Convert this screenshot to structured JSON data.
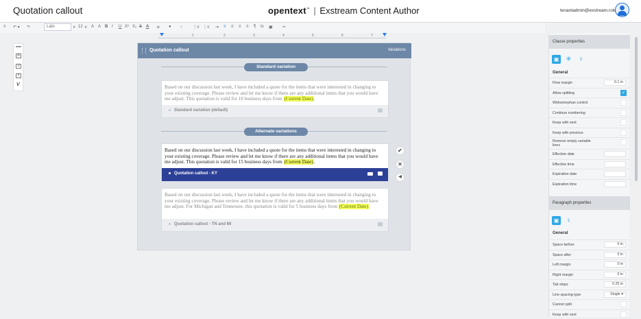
{
  "header": {
    "title": "Quotation callout",
    "brand_name": "opentext",
    "brand_sep": "|",
    "product": "Exstream Content Author",
    "user": "tenantadmin@exstream.role"
  },
  "toolbar": {
    "font": "Lato",
    "size": "12",
    "items": [
      "≡",
      "↶ ▾",
      "↷",
      "A",
      "A",
      "B",
      "I",
      "U",
      "X²",
      "X₂",
      "S",
      "A",
      "⌀",
      "●",
      "⁘",
      "⋮≡",
      "⋮≡",
      "⇥",
      "≡",
      "≡",
      "≡",
      "≡",
      "¶",
      "Ix",
      "▣",
      "✂"
    ]
  },
  "ruler": {
    "marks": [
      "1",
      "2",
      "3",
      "4",
      "5",
      "6",
      "7"
    ]
  },
  "doc": {
    "title": "Quotation callout",
    "variations_link": "Variations",
    "standard_pill": "Standard variation",
    "alternate_pill": "Alternate variations",
    "cards": [
      {
        "text": "Based on our discussion last week, I have included a quote for the items that were interested in changing to your existing coverage.  Please review and let me know if there are any additional items that you would have me adjust.  This quotation is valid for 10 business days from ",
        "date": "(Current Date)",
        "end": ".",
        "label": "Standard variation (default)"
      },
      {
        "text": "Based on our discussion last week, I have included a quote for the items that were interested in changing to your existing coverage.  Please review and let me know if there are any additional items that you would have me adjust.  This quotation is valid for 15 business days from ",
        "date": "(Current Date)",
        "end": ".",
        "label": "Quotation callout - KY"
      },
      {
        "text": "Based on our discussion last week, I have included a quote for the items that were interested in changing to your existing coverage.  Please review and let me know if there are any additional items that you would have me adjust.  For Michigan and Tennessee, this quotation is valid for 5 business days from ",
        "date": "(Current Date)",
        "end": ".",
        "label": "Quotation callout - TN and MI"
      }
    ],
    "actions": {
      "accept": "✔",
      "reject": "✕",
      "back": "◀"
    }
  },
  "panel": {
    "clause_title": "Clause properties",
    "general": "General",
    "clause_rows": [
      {
        "k": "Flow margin",
        "v": "0.1 in"
      },
      {
        "k": "Allow splitting",
        "check": true
      },
      {
        "k": "Widow/orphan control",
        "check": false
      },
      {
        "k": "Continue numbering",
        "check": false
      },
      {
        "k": "Keep with next",
        "check": false
      },
      {
        "k": "Keep with previous",
        "check": false
      },
      {
        "k": "Remove empty variable lines",
        "check": false
      },
      {
        "k": "Effective date",
        "v": ""
      },
      {
        "k": "Effective time",
        "v": ""
      },
      {
        "k": "Expiration date",
        "v": ""
      },
      {
        "k": "Expiration time",
        "v": ""
      }
    ],
    "para_title": "Paragraph properties",
    "para_rows": [
      {
        "k": "Space before",
        "v": "0 in"
      },
      {
        "k": "Space after",
        "v": "0 in"
      },
      {
        "k": "Left margin",
        "v": "0 in"
      },
      {
        "k": "Right margin",
        "v": "0 in"
      },
      {
        "k": "Tab stops",
        "v": "0.25 in"
      },
      {
        "k": "Line spacing type",
        "v": "Single  ▾"
      },
      {
        "k": "Cannot split",
        "check": false
      },
      {
        "k": "Keep with next",
        "check": false
      }
    ]
  },
  "colors": {
    "accent": "#2ba8e6",
    "header_bar": "#6d87a7",
    "active_footer": "#2d4097",
    "highlight": "#f5ff5c"
  }
}
